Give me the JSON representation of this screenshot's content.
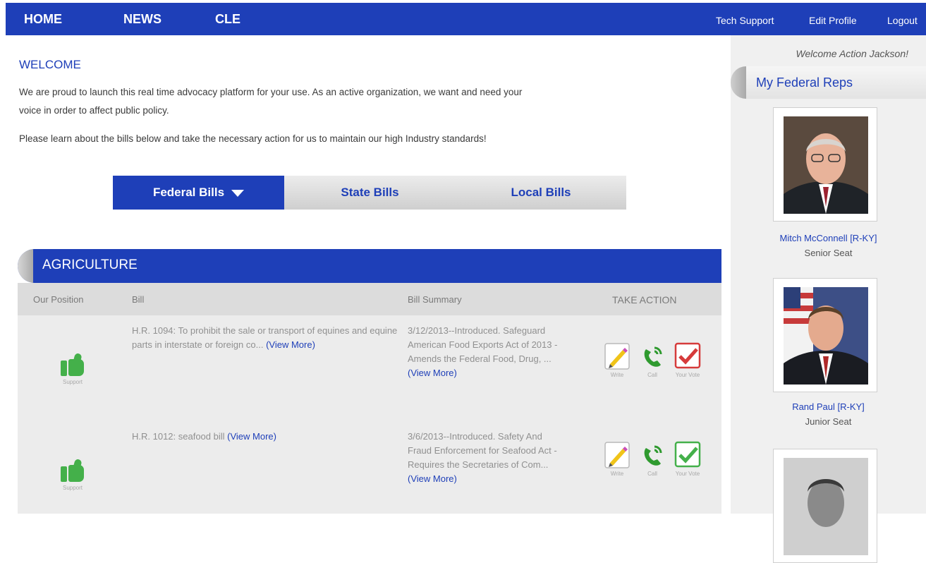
{
  "nav": {
    "home": "HOME",
    "news": "NEWS",
    "cle": "CLE",
    "tech_support": "Tech Support",
    "edit_profile": "Edit Profile",
    "logout": "Logout"
  },
  "welcome": {
    "title": "WELCOME",
    "line1": "We are proud to launch this real time advocacy platform for your use.  As an active organization, we want and need your",
    "line2": "voice in order to affect public policy.",
    "line3": "Please learn about the bills below and take the necessary action for us to maintain our high Industry standards!"
  },
  "tabs": [
    {
      "label": "Federal Bills",
      "active": true
    },
    {
      "label": "State Bills",
      "active": false
    },
    {
      "label": "Local Bills",
      "active": false
    }
  ],
  "section": {
    "title": "AGRICULTURE",
    "headers": {
      "position": "Our Position",
      "bill": "Bill",
      "summary": "Bill Summary",
      "action": "TAKE ACTION"
    }
  },
  "rows": [
    {
      "position": "Support",
      "bill": "H.R. 1094: To prohibit the sale or transport of equines and equine parts in interstate or foreign co...",
      "bill_link": "(View More)",
      "summary": "3/12/2013--Introduced. Safeguard American Food Exports Act of 2013 - Amends the Federal Food, Drug, ...",
      "summary_link": "(View More)",
      "write": "Write",
      "call": "Call",
      "vote": "Your Vote",
      "vote_color": "#d63b3b"
    },
    {
      "position": "Support",
      "bill": "H.R. 1012: seafood bill",
      "bill_link": "(View More)",
      "summary": "3/6/2013--Introduced. Safety And Fraud Enforcement for Seafood Act - Requires the Secretaries of Com...",
      "summary_link": "(View More)",
      "write": "Write",
      "call": "Call",
      "vote": "Your Vote",
      "vote_color": "#44b04a"
    }
  ],
  "sidebar": {
    "welcome_user": "Welcome Action Jackson!",
    "title": "My Federal Reps",
    "reps": [
      {
        "name": "Mitch McConnell [R-KY]",
        "seat": "Senior Seat"
      },
      {
        "name": "Rand Paul [R-KY]",
        "seat": "Junior Seat"
      }
    ]
  },
  "colors": {
    "brand": "#1e3fb8",
    "support_green": "#44b04a"
  }
}
